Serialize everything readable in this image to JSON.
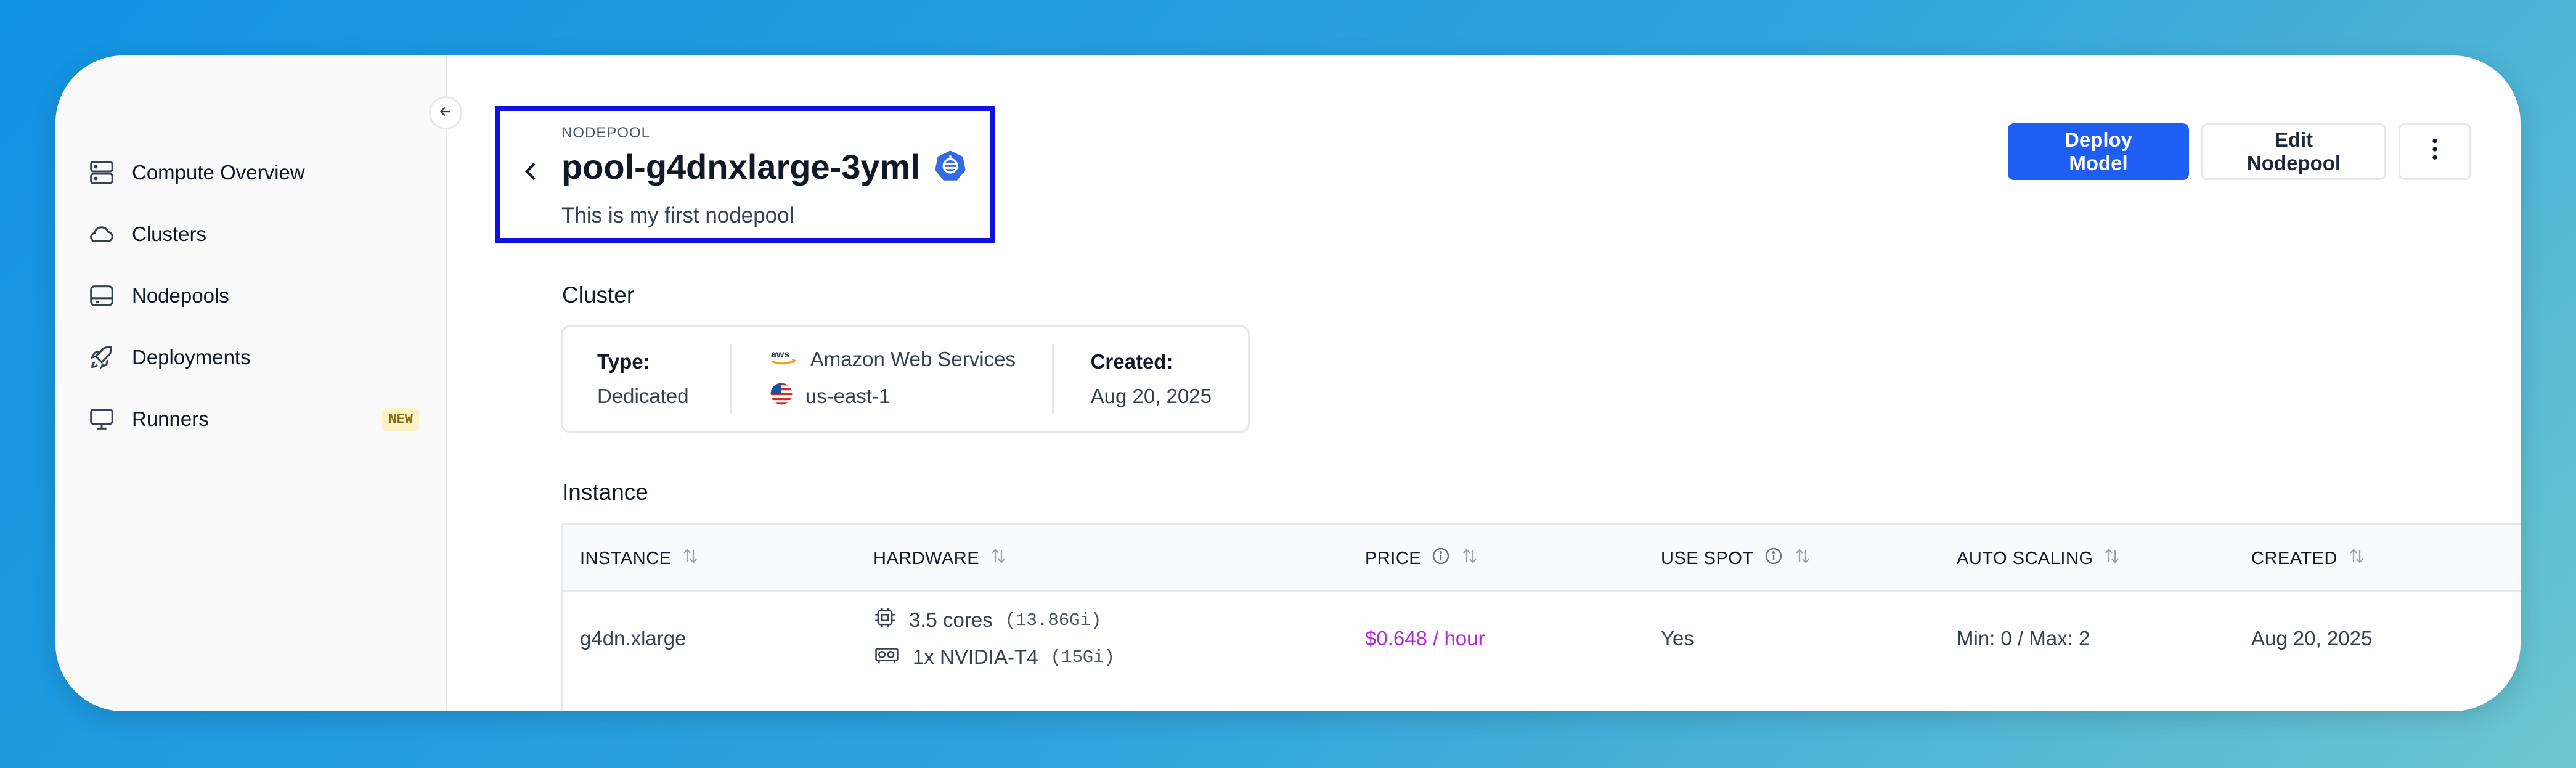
{
  "sidebar": {
    "items": [
      {
        "label": "Compute Overview",
        "icon": "server-icon"
      },
      {
        "label": "Clusters",
        "icon": "cloud-icon"
      },
      {
        "label": "Nodepools",
        "icon": "drive-icon"
      },
      {
        "label": "Deployments",
        "icon": "rocket-icon"
      },
      {
        "label": "Runners",
        "icon": "monitor-icon",
        "badge": "NEW"
      }
    ]
  },
  "header": {
    "eyebrow": "NODEPOOL",
    "title": "pool-g4dnxlarge-3yml",
    "description": "This is my first nodepool",
    "deploy_label": "Deploy Model",
    "edit_label": "Edit Nodepool"
  },
  "cluster": {
    "section_title": "Cluster",
    "type_label": "Type:",
    "type_value": "Dedicated",
    "provider": "Amazon Web Services",
    "region": "us-east-1",
    "created_label": "Created:",
    "created_value": "Aug 20, 2025"
  },
  "instance": {
    "section_title": "Instance",
    "columns": [
      "INSTANCE",
      "HARDWARE",
      "PRICE",
      "USE SPOT",
      "AUTO SCALING",
      "CREATED"
    ],
    "row": {
      "instance": "g4dn.xlarge",
      "cpu": "3.5 cores",
      "cpu_mem": "(13.86Gi)",
      "gpu": "1x NVIDIA-T4",
      "gpu_mem": "(15Gi)",
      "price": "$0.648 / hour",
      "use_spot": "Yes",
      "auto_scaling": "Min: 0 / Max: 2",
      "created": "Aug 20, 2025"
    }
  },
  "colors": {
    "accent": "#1f5ef5",
    "price": "#b02bd6",
    "highlight_box": "#1010e0"
  }
}
